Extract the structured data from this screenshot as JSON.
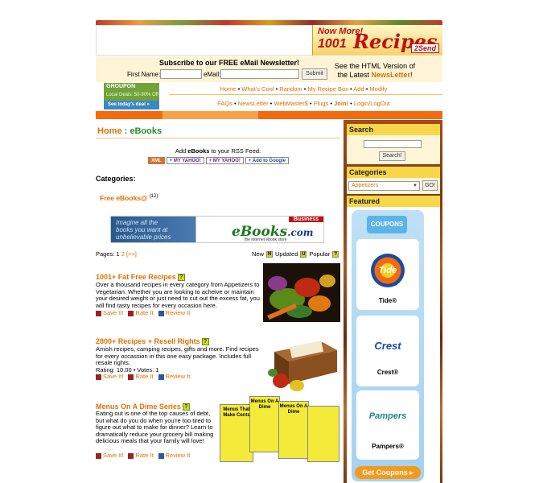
{
  "header": {
    "banner": {
      "line1": "Now More!",
      "number": "1001",
      "word": "Recipes",
      "badge": "2Send"
    }
  },
  "newsletter": {
    "title": "Subscribe to our FREE eMail Newsletter!",
    "first_name_label": "First Name:",
    "email_label": "eMail:",
    "submit_label": "Submit",
    "html_version_prefix": "See the HTML Version of the Latest ",
    "html_version_link": "NewsLetter",
    "html_version_suffix": "!"
  },
  "groupon": {
    "brand": "GROUPON",
    "subtitle": "Local Deals: 50-90% Off",
    "cta": "See today's deal »"
  },
  "nav": {
    "row1": [
      "Home",
      "What's Cool",
      "Random",
      "My Recipe Box",
      "Add",
      "Modify"
    ],
    "row2": [
      "FAQs",
      "NewsLetter",
      "WebMaster$",
      "Plugs",
      "Join!",
      "Login/LogOut"
    ]
  },
  "breadcrumb": {
    "home": "Home",
    "separator": " : ",
    "current": "eBooks"
  },
  "rss": {
    "label_prefix": "Add ",
    "label_bold": "eBooks",
    "label_suffix": " to your RSS Feed:",
    "buttons": [
      "XML",
      "+ MY YAHOO!",
      "+ MY YAHOO!",
      "+ Add to Google"
    ]
  },
  "categories": {
    "heading": "Categories:",
    "items": [
      {
        "label": "Free eBooks@",
        "count": "(12)"
      }
    ]
  },
  "ebooks_banner": {
    "tagline_1": "Imagine all the",
    "tagline_2": "books you want at",
    "tagline_3": "unbelievable prices",
    "badge": "Business",
    "logo_main": "eBooks",
    "logo_suffix": ".com",
    "logo_sub": "the internet ebook store"
  },
  "pagination": {
    "label": "Pages: 1 ",
    "page2": "2",
    "next": "[>>]"
  },
  "sort": {
    "new": "New",
    "updated": "Updated",
    "popular": "Popular"
  },
  "listings": [
    {
      "title": "1001+ Fat Free Recipes",
      "description": "Over a thousand recipes in every category from Appetizers to Vegetarian. Whether you are looking to acheive or maintain your desired weight or just need to cut out the excess fat, you will find tasty recipes for every occasion here.",
      "rating": "",
      "actions": [
        "Save It!",
        "Rate It",
        "Review It"
      ]
    },
    {
      "title": "2800+ Recipes + Resell Rights",
      "description": "Amish recipes, camping recipes, gifts and more. Find recipes for every occassion in this one easy package. Includes full resale rights.",
      "rating": "Rating: 10.00 • Votes: 1",
      "actions": [
        "Save It!",
        "Rate It",
        "Review It"
      ]
    },
    {
      "title": "Menus On A Dime Series",
      "description": "Eating out is one of the top causes of debt, but what do you do when you're too tired to figure out what to make for dinner? Learn to dramatically reduce your grocery bill making delicious meals that your family will love!",
      "rating": "",
      "actions": [
        "Save It!",
        "Rate It",
        "Review It"
      ]
    }
  ],
  "book_covers": [
    "Menus That Make Cents",
    "Menus On A Dime",
    "Menus On A Dime"
  ],
  "sidebar": {
    "search_heading": "Search",
    "search_button": "Search!",
    "categories_heading": "Categories",
    "category_selected": "Appetizers",
    "go_button": "GO!",
    "featured_heading": "Featured",
    "coupons_logo": "COUPONS",
    "products": [
      "Tide®",
      "Crest®",
      "Pampers®"
    ],
    "product_logos": [
      "Tide",
      "Crest",
      "Pampers"
    ],
    "get_coupons": "Get Coupons ▸"
  },
  "colors": {
    "accent": "#e07000",
    "title_green": "#2a8a2a",
    "orange_bar": "#f26b0f",
    "sidebar_head": "#f7d64a"
  }
}
